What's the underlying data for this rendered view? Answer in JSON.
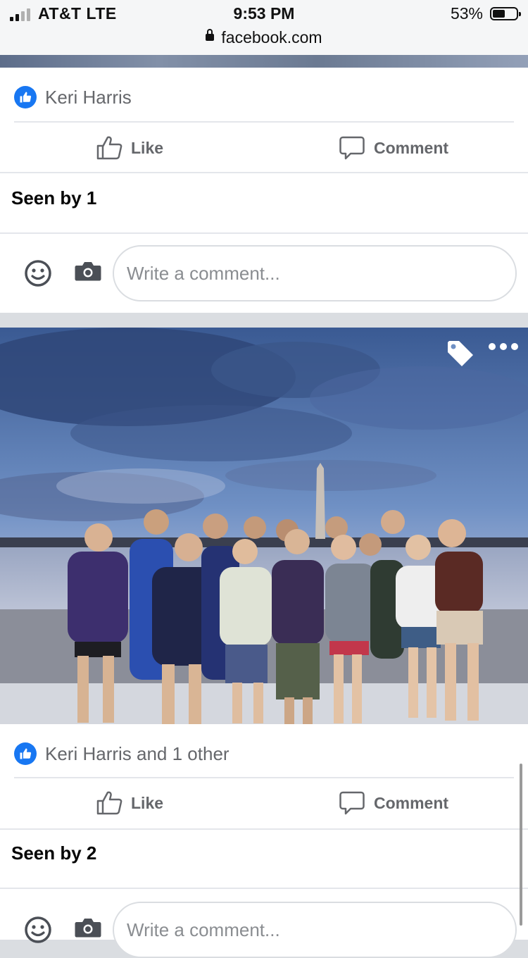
{
  "status_bar": {
    "carrier": "AT&T  LTE",
    "time": "9:53 PM",
    "battery_percent_text": "53%",
    "battery_level": 0.53,
    "signal_bars": 2,
    "url": "facebook.com"
  },
  "post1": {
    "reactions_text": "Keri Harris",
    "like_label": "Like",
    "comment_label": "Comment",
    "seen_text": "Seen by 1",
    "comment_placeholder": "Write a comment..."
  },
  "post2": {
    "photo_icons": [
      "tag-icon",
      "more-options-icon"
    ],
    "reactions_text": "Keri Harris and 1 other",
    "like_label": "Like",
    "comment_label": "Comment",
    "seen_text": "Seen by 2",
    "comment_placeholder": "Write a comment..."
  },
  "colors": {
    "facebook_blue": "#1877f2",
    "secondary_text": "#65676b",
    "primary_text": "#050505",
    "feed_background": "#dadde1"
  }
}
